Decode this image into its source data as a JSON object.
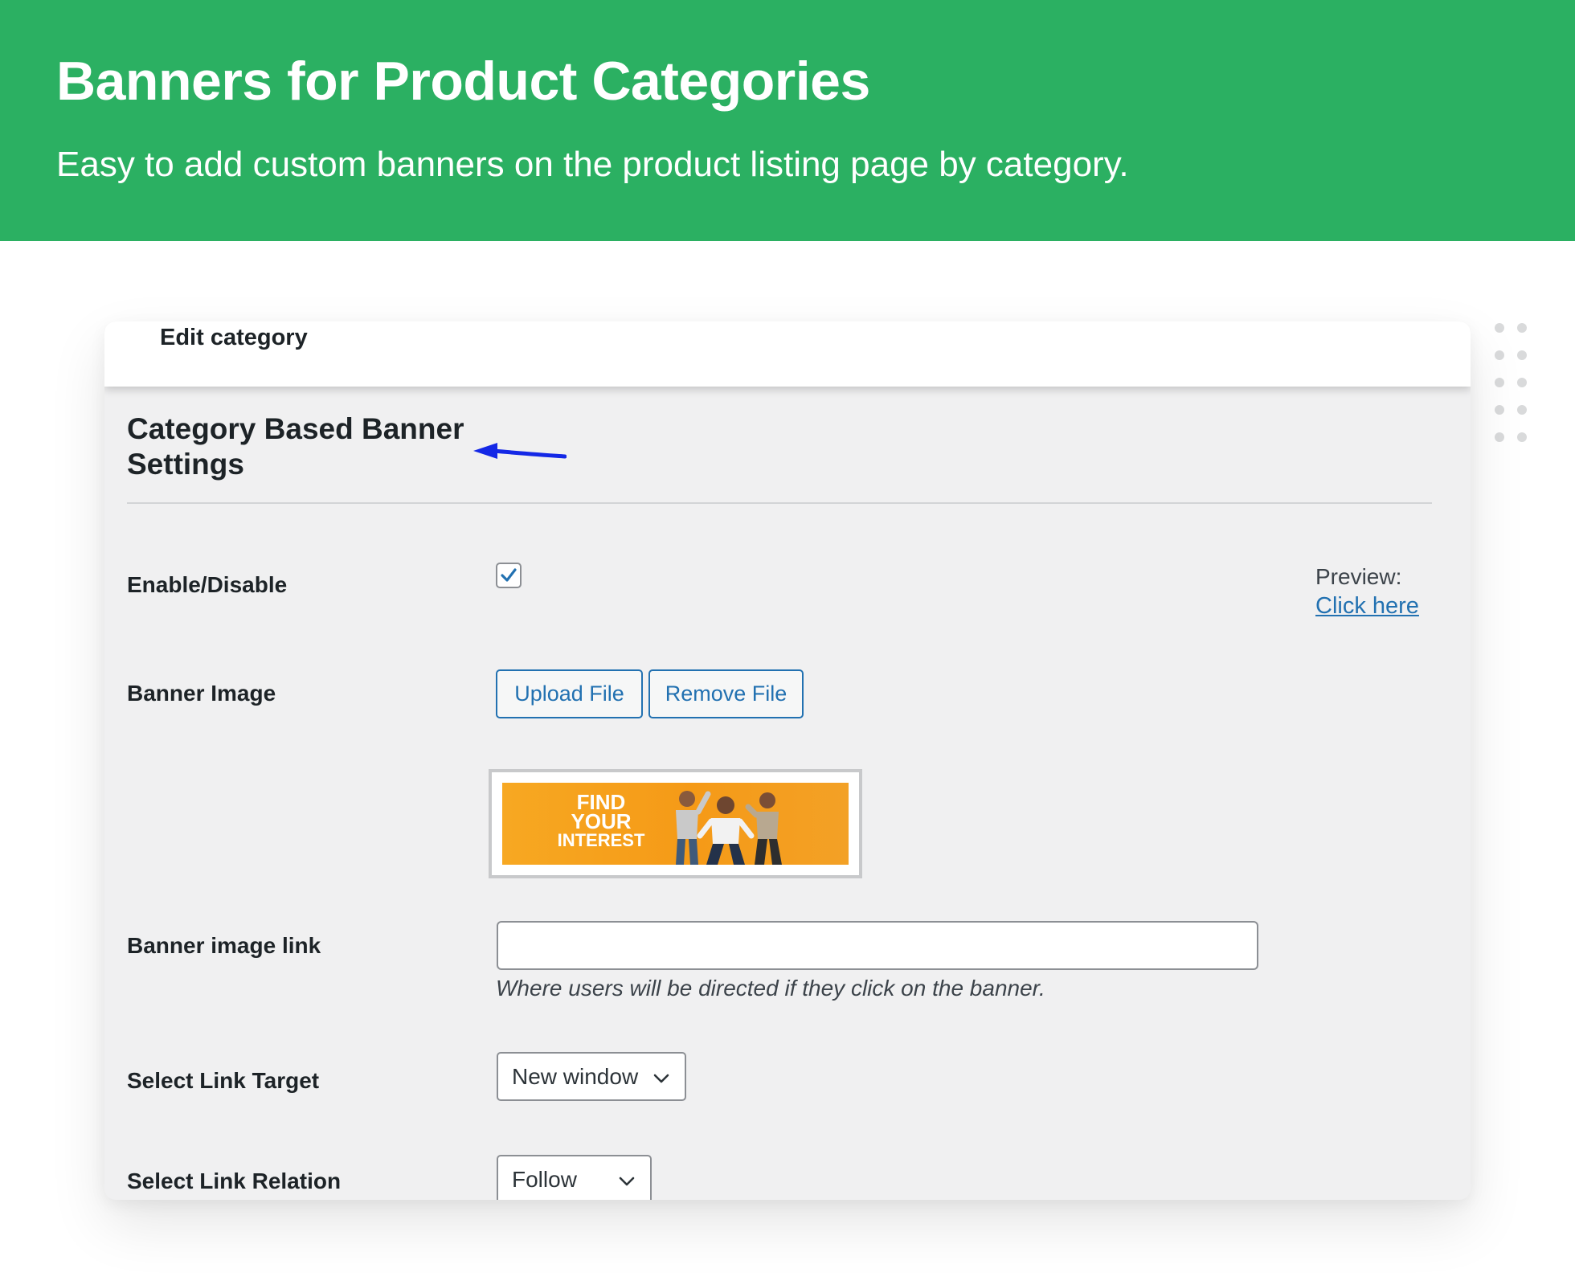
{
  "hero": {
    "title": "Banners for Product Categories",
    "subtitle": "Easy to add custom banners on the product listing page by category."
  },
  "card": {
    "top_title": "Edit category",
    "section_title": "Category Based Banner Settings",
    "enable": {
      "label": "Enable/Disable",
      "checked": true,
      "preview_label": "Preview:",
      "preview_link": "Click here"
    },
    "banner_image": {
      "label": "Banner Image",
      "upload_button": "Upload File",
      "remove_button": "Remove File",
      "preview_line1": "FIND",
      "preview_line2": "YOUR",
      "preview_line3": "INTEREST"
    },
    "banner_link": {
      "label": "Banner image link",
      "value": "",
      "help": "Where users will be directed if they click on the banner."
    },
    "link_target": {
      "label": "Select Link Target",
      "selected": "New window"
    },
    "link_relation": {
      "label": "Select Link Relation",
      "selected": "Follow"
    }
  },
  "colors": {
    "hero_bg": "#2bb062",
    "accent": "#2271b1",
    "arrow": "#1428e6",
    "banner_orange": "#f7a822"
  }
}
